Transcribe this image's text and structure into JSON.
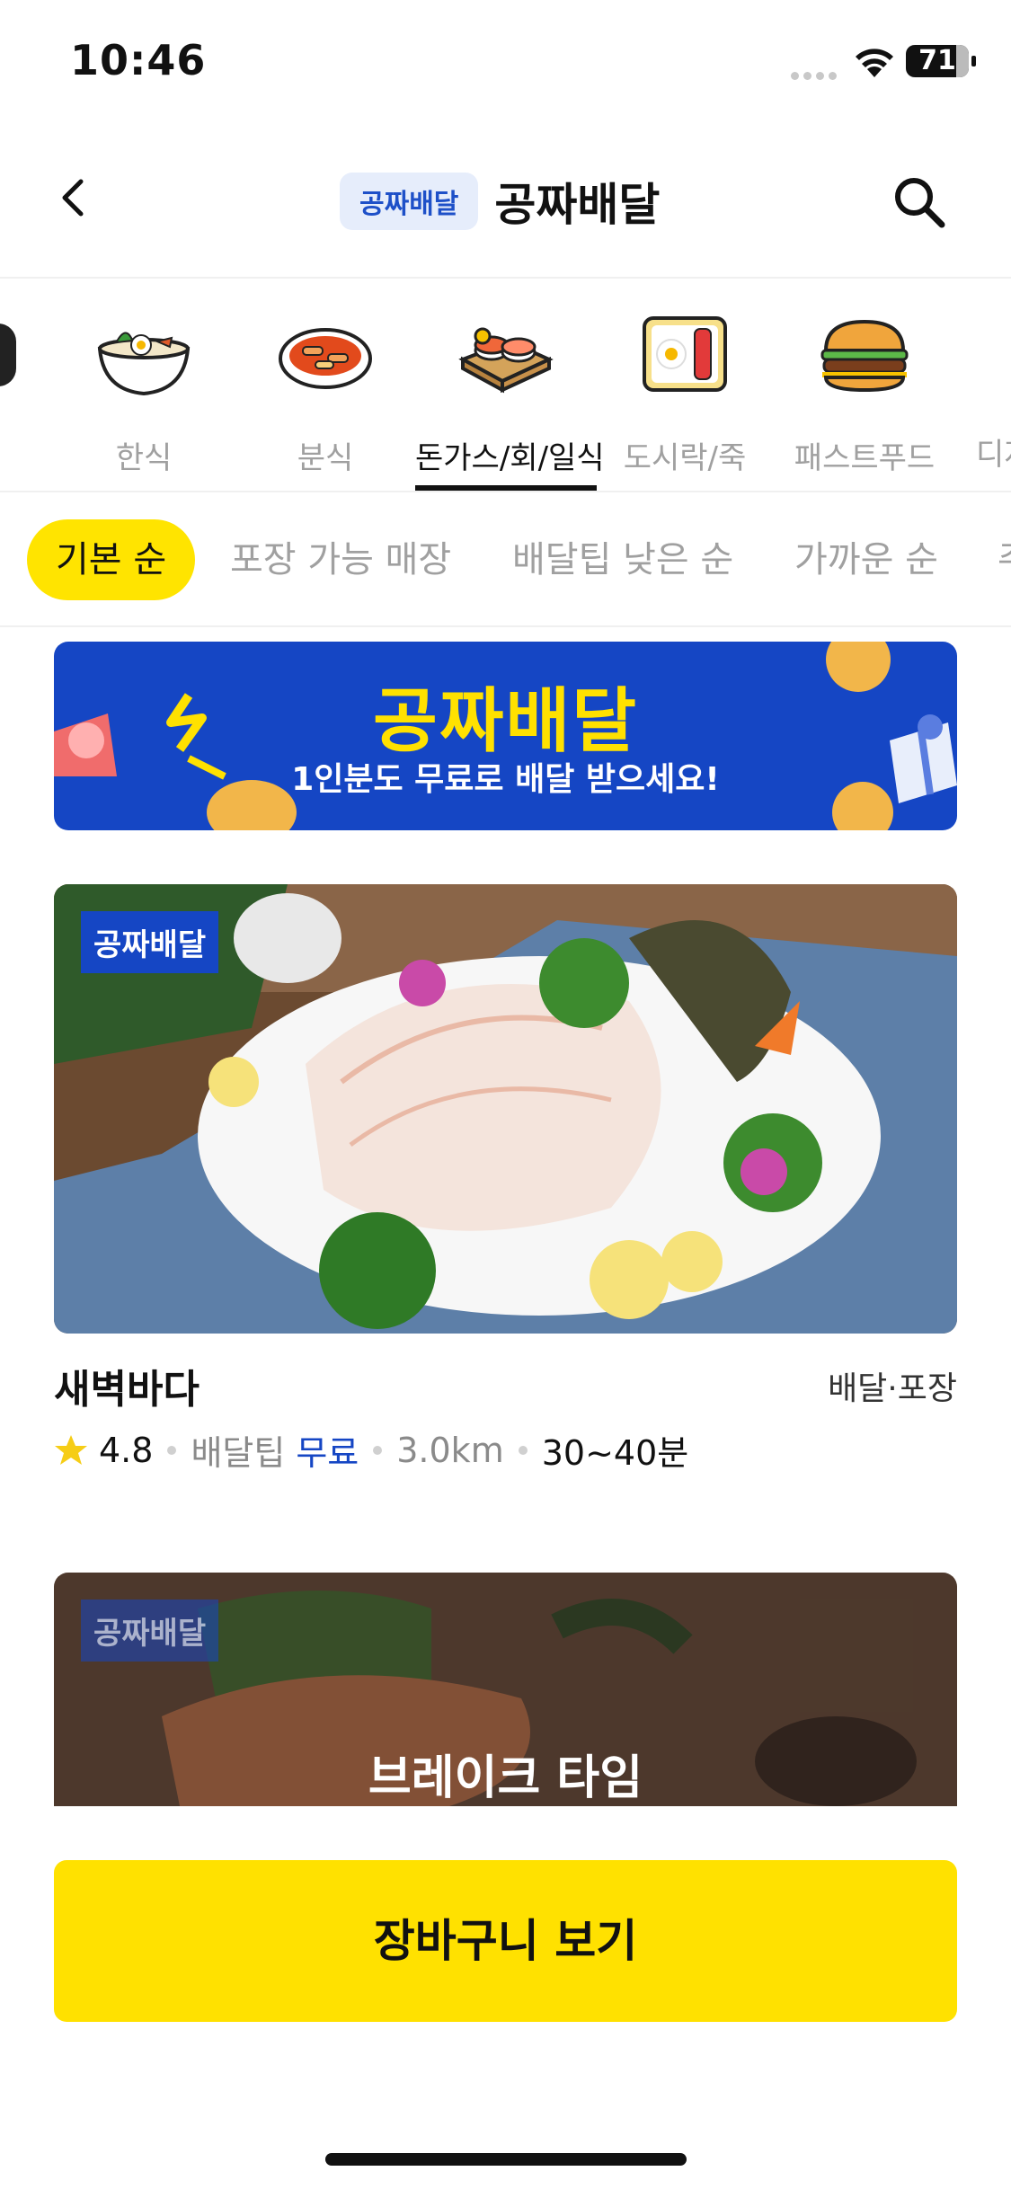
{
  "status_bar": {
    "time": "10:46",
    "battery": "71"
  },
  "header": {
    "chip": "공짜배달",
    "title": "공짜배달",
    "icons": [
      "back-chevron-icon",
      "search-icon"
    ]
  },
  "categories": [
    {
      "label": "한식",
      "icon": "bibimbap-icon",
      "active": false
    },
    {
      "label": "분식",
      "icon": "tteokbokki-icon",
      "active": false
    },
    {
      "label": "돈가스/회/일식",
      "icon": "sushi-icon",
      "active": true
    },
    {
      "label": "도시락/죽",
      "icon": "lunchbox-icon",
      "active": false
    },
    {
      "label": "패스트푸드",
      "icon": "burger-icon",
      "active": false
    },
    {
      "label": "디저",
      "icon": "dessert-icon",
      "active": false
    }
  ],
  "filters": [
    "기본 순",
    "포장 가능 매장",
    "배달팁 낮은 순",
    "가까운 순",
    "주"
  ],
  "banner": {
    "title": "공짜배달",
    "subtitle": "1인분도 무료로 배달 받으세요!"
  },
  "store": {
    "badge": "공짜배달",
    "name": "새벽바다",
    "type": "배달·포장",
    "rating": "4.8",
    "tip_label": "배달팁",
    "tip_value": "무료",
    "distance": "3.0km",
    "time": "30~40분"
  },
  "store2": {
    "badge": "공짜배달",
    "status": "브레이크 타임"
  },
  "cart_button": "장바구니 보기",
  "colors": {
    "accent_yellow": "#ffe100",
    "brand_blue": "#1546c4"
  }
}
